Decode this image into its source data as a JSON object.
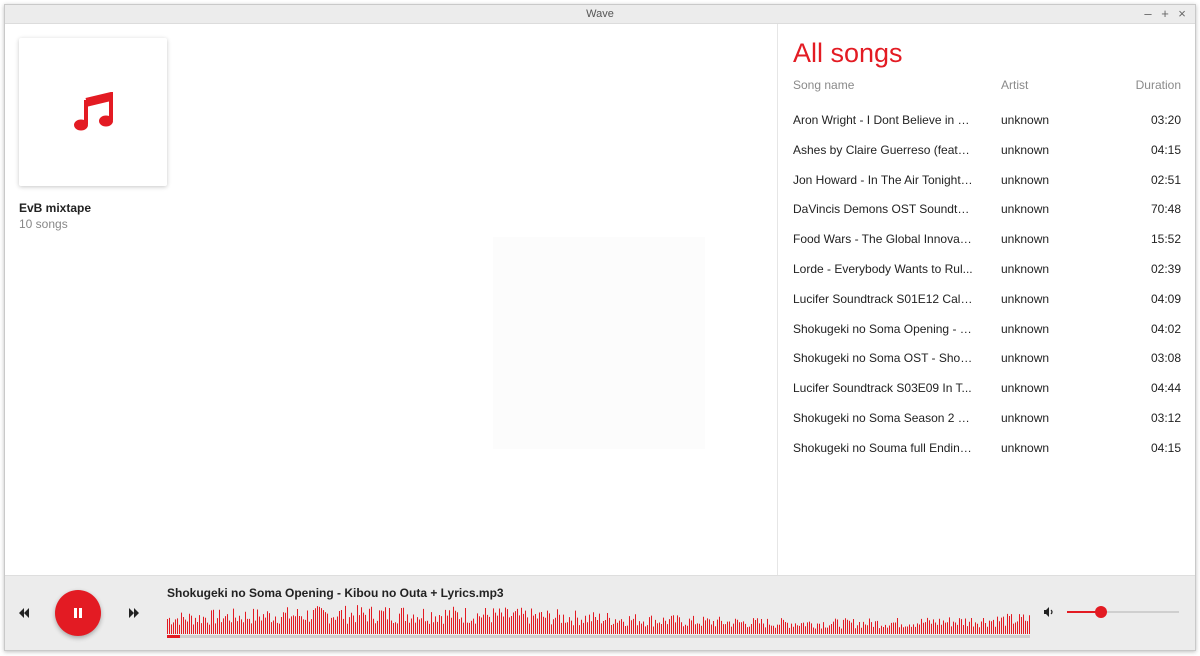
{
  "window": {
    "title": "Wave",
    "controls": [
      "–",
      "+",
      "×"
    ]
  },
  "album": {
    "name": "EvB mixtape",
    "count": "10 songs",
    "icon": "music-note-icon"
  },
  "songs": {
    "title": "All songs",
    "headers": {
      "name": "Song name",
      "artist": "Artist",
      "duration": "Duration"
    },
    "rows": [
      {
        "name": "Aron Wright - I Dont Believe in S...",
        "artist": "unknown",
        "duration": "03:20"
      },
      {
        "name": "Ashes by Claire Guerreso (feat. o...",
        "artist": "unknown",
        "duration": "04:15"
      },
      {
        "name": "Jon Howard - In The Air Tonight....",
        "artist": "unknown",
        "duration": "02:51"
      },
      {
        "name": "DaVincis Demons OST Soundtra...",
        "artist": "unknown",
        "duration": "70:48"
      },
      {
        "name": "Food Wars - The Global Innovat...",
        "artist": "unknown",
        "duration": "15:52"
      },
      {
        "name": "Lorde - Everybody Wants to Rul...",
        "artist": "unknown",
        "duration": "02:39"
      },
      {
        "name": "Lucifer Soundtrack S01E12 Call ...",
        "artist": "unknown",
        "duration": "04:09"
      },
      {
        "name": "Shokugeki no Soma Opening - Ki...",
        "artist": "unknown",
        "duration": "04:02"
      },
      {
        "name": "Shokugeki no Soma OST - Shoku...",
        "artist": "unknown",
        "duration": "03:08"
      },
      {
        "name": "Lucifer Soundtrack S03E09 In T...",
        "artist": "unknown",
        "duration": "04:44"
      },
      {
        "name": "Shokugeki no Soma Season 2 OS...",
        "artist": "unknown",
        "duration": "03:12"
      },
      {
        "name": "Shokugeki no Souma full Ending ...",
        "artist": "unknown",
        "duration": "04:15"
      }
    ]
  },
  "player": {
    "now_playing": "Shokugeki no Soma Opening - Kibou no Outa + Lyrics.mp3",
    "state": "playing",
    "progress": 0.015,
    "volume": 0.3,
    "accent": "#e31b23"
  }
}
